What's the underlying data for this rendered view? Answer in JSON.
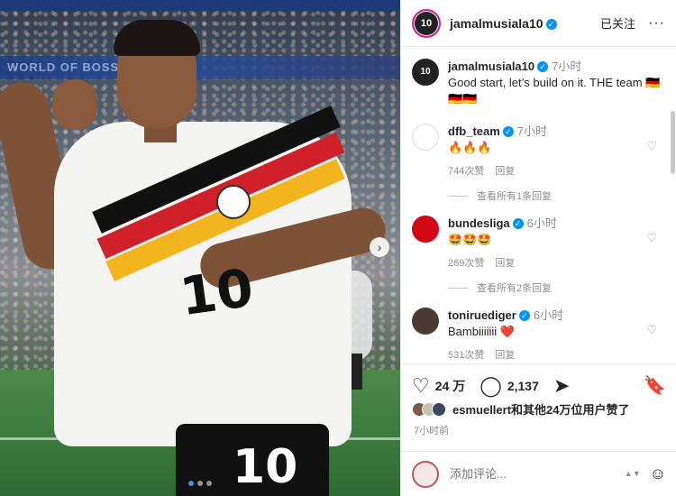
{
  "photo": {
    "banner_text": "WORLD OF BOSS",
    "shirt_number": "10",
    "shorts_number": "10",
    "next_icon": "›",
    "carousel_total": 3,
    "carousel_active": 1
  },
  "header": {
    "username": "jamalmusiala10",
    "verified_icon": "✓",
    "follow_label": "已关注",
    "more_icon": "···"
  },
  "caption": {
    "username": "jamalmusiala10",
    "time": "7小时",
    "text": "Good start, let’s build on it. THE team 🇩🇪🇩🇪🇩🇪"
  },
  "comments": [
    {
      "username": "dfb_team",
      "time": "7小时",
      "text": "🔥🔥🔥",
      "likes": "744次赞",
      "reply_label": "回复",
      "view_replies": "查看所有1条回复"
    },
    {
      "username": "bundesliga",
      "time": "6小时",
      "text": "🤩🤩🤩",
      "likes": "269次赞",
      "reply_label": "回复",
      "view_replies": "查看所有2条回复"
    },
    {
      "username": "toniruediger",
      "time": "6小时",
      "text": "Bambiiiiiii ❤️",
      "likes": "531次赞",
      "reply_label": "回复"
    }
  ],
  "actions": {
    "like_icon": "♡",
    "like_count": "24 万",
    "comment_icon": "◯",
    "comment_count": "2,137",
    "share_icon": "➤",
    "bookmark_icon": "🔖"
  },
  "likes_summary": {
    "text": "esmuellert和其他24万位用户赞了"
  },
  "post_time": "7小时前",
  "add_comment": {
    "placeholder": "添加评论...",
    "emoji_icon": "☺",
    "updown_icon": "▲▼"
  },
  "colors": {
    "verified": "#0095f6",
    "heart": "#ed4956",
    "muted": "#8e8e8e"
  }
}
